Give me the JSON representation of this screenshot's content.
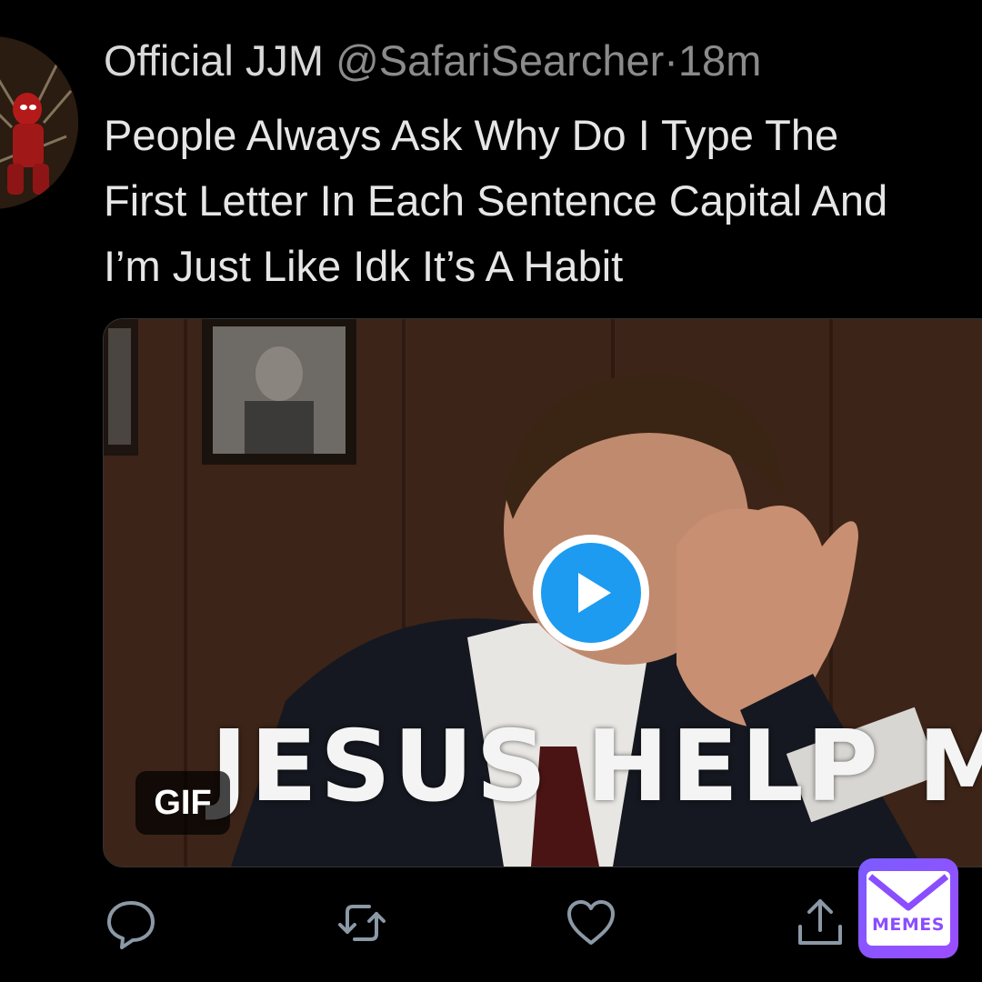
{
  "tweet": {
    "display_name": "Official JJM",
    "handle": "@SafariSearcher",
    "separator": "·",
    "time": "18m",
    "text_lines": [
      "People Always Ask Why Do I Type The",
      "First Letter In Each Sentence Capital And",
      "I’m Just Like Idk It’s A Habit"
    ]
  },
  "media": {
    "caption": "JESUS HELP ME",
    "badge": "GIF",
    "play_icon": "play-icon"
  },
  "actions": {
    "icons": [
      "reply-icon",
      "retweet-icon",
      "like-icon",
      "share-icon"
    ],
    "icon_color": "#8b98a5"
  },
  "watermark": {
    "text": "MEMES",
    "color": "#8a4dff"
  },
  "colors": {
    "background": "#000000",
    "accent": "#1d9bf0"
  }
}
